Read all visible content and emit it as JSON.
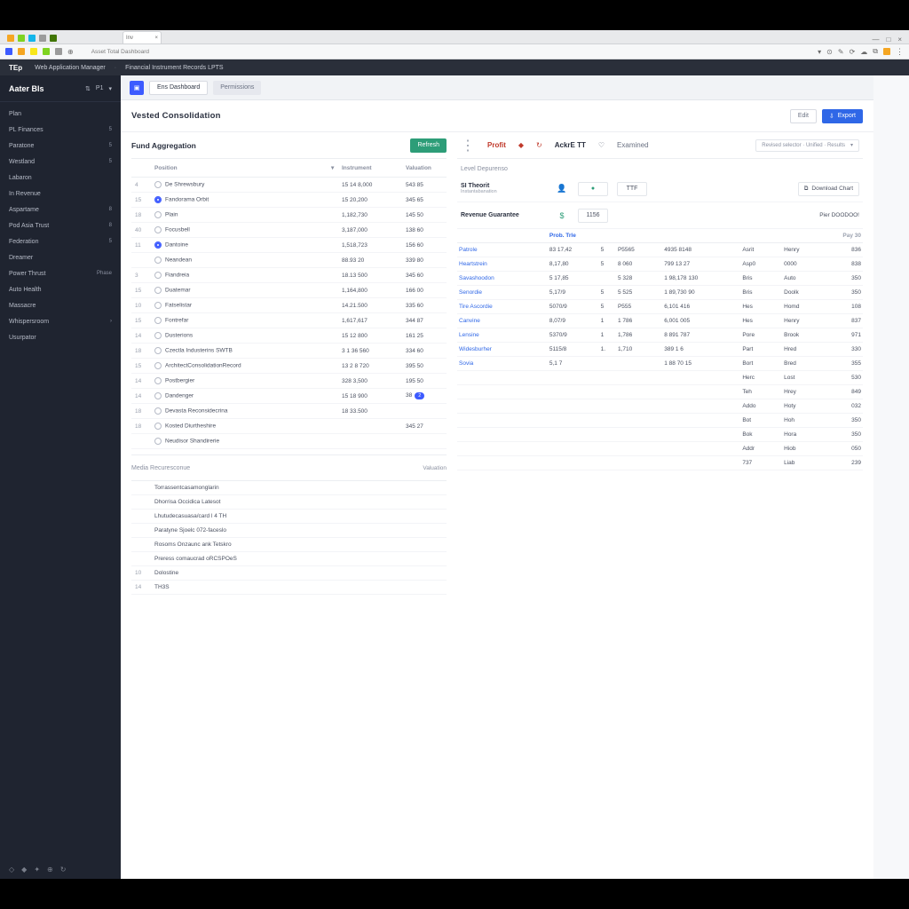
{
  "browser": {
    "tab_label": "Inv",
    "address": "Asset Total Dashboard",
    "favicon_colors": [
      "#f5a623",
      "#7ed321",
      "#13b5ea",
      "#4a4a4a",
      "#417505"
    ],
    "toolbar_colors": [
      "#3d5bff",
      "#f5a623",
      "#f8e71c",
      "#7ed321",
      "#13b5ea"
    ]
  },
  "header": {
    "brand": "TEp",
    "crumbs": [
      "Web Application Manager",
      "Financial Instrument Records LPTS"
    ]
  },
  "sidebar": {
    "title": "Aater Bls",
    "top_badge": "P1",
    "items": [
      {
        "label": "Plan",
        "badge": ""
      },
      {
        "label": "PL Finances",
        "badge": "5"
      },
      {
        "label": "Paratone",
        "badge": "5"
      },
      {
        "label": "Westland",
        "badge": "5"
      },
      {
        "label": "Labaron",
        "badge": ""
      },
      {
        "label": "In Revenue",
        "badge": ""
      },
      {
        "label": "Aspartame",
        "badge": "8"
      },
      {
        "label": "Pod Asia Trust",
        "badge": "8"
      },
      {
        "label": "Federation",
        "badge": "5"
      },
      {
        "label": "Dreamer",
        "badge": ""
      },
      {
        "label": "Power Thrust",
        "badge": "Phase"
      },
      {
        "label": "Auto Health",
        "badge": ""
      },
      {
        "label": "Massacre",
        "badge": ""
      },
      {
        "label": "Whispersroom",
        "badge": "›"
      },
      {
        "label": "Usurpator",
        "badge": ""
      }
    ]
  },
  "top_chips": {
    "icon": "▣",
    "primary": "Ens Dashboard",
    "ghost": "Permissions"
  },
  "page": {
    "title": "Vested Consolidation",
    "edit_btn": "Edit",
    "export_btn": "Export"
  },
  "left_panel": {
    "section_title": "Fund Aggregation",
    "action_btn": "Refresh",
    "columns": [
      "",
      "Position",
      "",
      "Instrument",
      "Valuation"
    ],
    "rows": [
      {
        "idx": "4",
        "name": "De Shrewsbury",
        "v1": "15 14 8,000",
        "v2": "543 85"
      },
      {
        "idx": "15",
        "name": "Fandorama Orbit",
        "v1": "15 20,200",
        "v2": "345 65",
        "sel": true
      },
      {
        "idx": "18",
        "name": "Plain",
        "v1": "1,182,730",
        "v2": "145 50"
      },
      {
        "idx": "40",
        "name": "Focusbell",
        "v1": "3,187,000",
        "v2": "138 60"
      },
      {
        "idx": "11",
        "name": "Dantoine",
        "v1": "1,518,723",
        "v2": "156 60",
        "sel": true
      },
      {
        "idx": "",
        "name": "Neandean",
        "v1": "88.93 20",
        "v2": "339 80"
      },
      {
        "idx": "3",
        "name": "Fiandreia",
        "v1": "18.13 500",
        "v2": "345 60"
      },
      {
        "idx": "15",
        "name": "Duatemar",
        "v1": "1,164,800",
        "v2": "166 00"
      },
      {
        "idx": "10",
        "name": "Fatselistar",
        "v1": "14.21.500",
        "v2": "335 60"
      },
      {
        "idx": "15",
        "name": "Fontrefar",
        "v1": "1,617,617",
        "v2": "344 87"
      },
      {
        "idx": "14",
        "name": "Dusterions",
        "v1": "15 12 800",
        "v2": "161 25"
      },
      {
        "idx": "18",
        "name": "Czectla Industerins SWTB",
        "v1": "3 1 36 560",
        "v2": "334 60"
      },
      {
        "idx": "15",
        "name": "ArchitectConsolidationRecord",
        "v1": "13 2 8 720",
        "v2": "395 50"
      },
      {
        "idx": "14",
        "name": "Postbergier",
        "v1": "328 3,500",
        "v2": "195 50"
      },
      {
        "idx": "14",
        "name": "Dandenger",
        "v1": "15 18 900",
        "v2": "38",
        "pill": "2"
      },
      {
        "idx": "18",
        "name": "Devasta Reconsidecrina",
        "v1": "18 33.500",
        "v2": ""
      },
      {
        "idx": "18",
        "name": "Kosted Diurtheshire",
        "v1": "",
        "v2": "345 27"
      },
      {
        "idx": "",
        "name": "Neudisor Shandirerie",
        "v1": "",
        "v2": ""
      }
    ],
    "section2_title": "Media Recuresconue",
    "section2_col": "Valuation",
    "rows2": [
      {
        "name": "Torrassentcasamonglarin"
      },
      {
        "name": "Dhorrisa Occidica Latesot"
      },
      {
        "name": "Lhutudecasuasa/card l 4 TH"
      },
      {
        "name": "Paratyne Sjoelc 072-faceslo"
      },
      {
        "name": "Rosoms Onzaunc ank Tetskro"
      },
      {
        "name": "Preress comaucrad oRCSPOeS"
      },
      {
        "idx": "10",
        "name": "Dolostine"
      },
      {
        "idx": "14",
        "name": "TH3S"
      }
    ]
  },
  "right_panel": {
    "tabs": [
      {
        "label": "Profit",
        "cls": "red"
      },
      {
        "label": "",
        "icon": "◆",
        "cls": ""
      },
      {
        "label": "",
        "icon": "↻",
        "cls": ""
      },
      {
        "label": "AckrE TT",
        "cls": "active"
      },
      {
        "label": "",
        "icon": "♡",
        "cls": ""
      },
      {
        "label": "Examined",
        "cls": ""
      }
    ],
    "selector": "Revised selector · Unified · Results",
    "sub1": "Level Depurenso",
    "kpis": [
      {
        "label": "SI Theorit",
        "sub": "Instantabanation",
        "ico": "👤",
        "ico_color": "#6a7182",
        "badges": [
          "●",
          "TTF"
        ],
        "btn": "Download Chart",
        "btn_ico": "⧉"
      },
      {
        "label": "Revenue Guarantee",
        "sub": "",
        "ico": "$",
        "ico_color": "#2d9d78",
        "badges": [
          "1156"
        ],
        "btn": "Pier DOODOO!",
        "extra": "",
        "right": "Pay 30"
      }
    ],
    "columns": [
      "Position",
      "",
      "",
      "",
      "",
      "",
      ""
    ],
    "head": [
      "Prob. Trle",
      "",
      "",
      "",
      "",
      "",
      "Pay 30"
    ],
    "rows": [
      {
        "name": "Patrole",
        "c": [
          "83 17,42",
          "5",
          "P5565",
          "4935 8148",
          "Asrit",
          "Henry",
          "836"
        ]
      },
      {
        "name": "Heartstrein",
        "c": [
          "8,17,80",
          "5",
          "8 060",
          "799 13 27",
          "Asp0",
          "0000",
          "838"
        ]
      },
      {
        "name": "Savashoodon",
        "c": [
          "5 17,85",
          "",
          "5 328",
          "1 98,178 130",
          "Bris",
          "Auto",
          "350"
        ]
      },
      {
        "name": "Senordie",
        "c": [
          "5,17/9",
          "5",
          "5 525",
          "1 89,730 90",
          "Bris",
          "Doolk",
          "350"
        ]
      },
      {
        "name": "Tire Ascordie",
        "c": [
          "5070/9",
          "5",
          "P555",
          "6,101 416",
          "Hes",
          "Homd",
          "108"
        ]
      },
      {
        "name": "Canvine",
        "c": [
          "8,07/9",
          "1",
          "1 786",
          "6,001 005",
          "Hes",
          "Henry",
          "837"
        ]
      },
      {
        "name": "Lensine",
        "c": [
          "5370/9",
          "1",
          "1,786",
          "8 891 787",
          "Pore",
          "Brook",
          "971"
        ]
      },
      {
        "name": "Widesburher",
        "c": [
          "5115/8",
          "1.",
          "1,710",
          "389 1 6",
          "Part",
          "Hred",
          "330"
        ]
      },
      {
        "name": "Sovia",
        "c": [
          "5,1 7",
          "",
          "",
          "1 88 70 15",
          "Bort",
          "Bred",
          "355"
        ]
      },
      {
        "name": "",
        "c": [
          "",
          "",
          "",
          "",
          "Herc",
          "Lost",
          "530"
        ]
      },
      {
        "name": "",
        "c": [
          "",
          "",
          "",
          "",
          "Teh",
          "Hrey",
          "849"
        ]
      },
      {
        "name": "",
        "c": [
          "",
          "",
          "",
          "",
          "Addo",
          "Hoty",
          "032"
        ]
      },
      {
        "name": "",
        "c": [
          "",
          "",
          "",
          "",
          "Bot",
          "Hoh",
          "350"
        ]
      },
      {
        "name": "",
        "c": [
          "",
          "",
          "",
          "",
          "Bok",
          "Hora",
          "350"
        ]
      },
      {
        "name": "",
        "c": [
          "",
          "",
          "",
          "",
          "Addr",
          "Hiob",
          "050"
        ]
      },
      {
        "name": "",
        "c": [
          "",
          "",
          "",
          "",
          "737",
          "Liab",
          "239"
        ]
      }
    ]
  }
}
